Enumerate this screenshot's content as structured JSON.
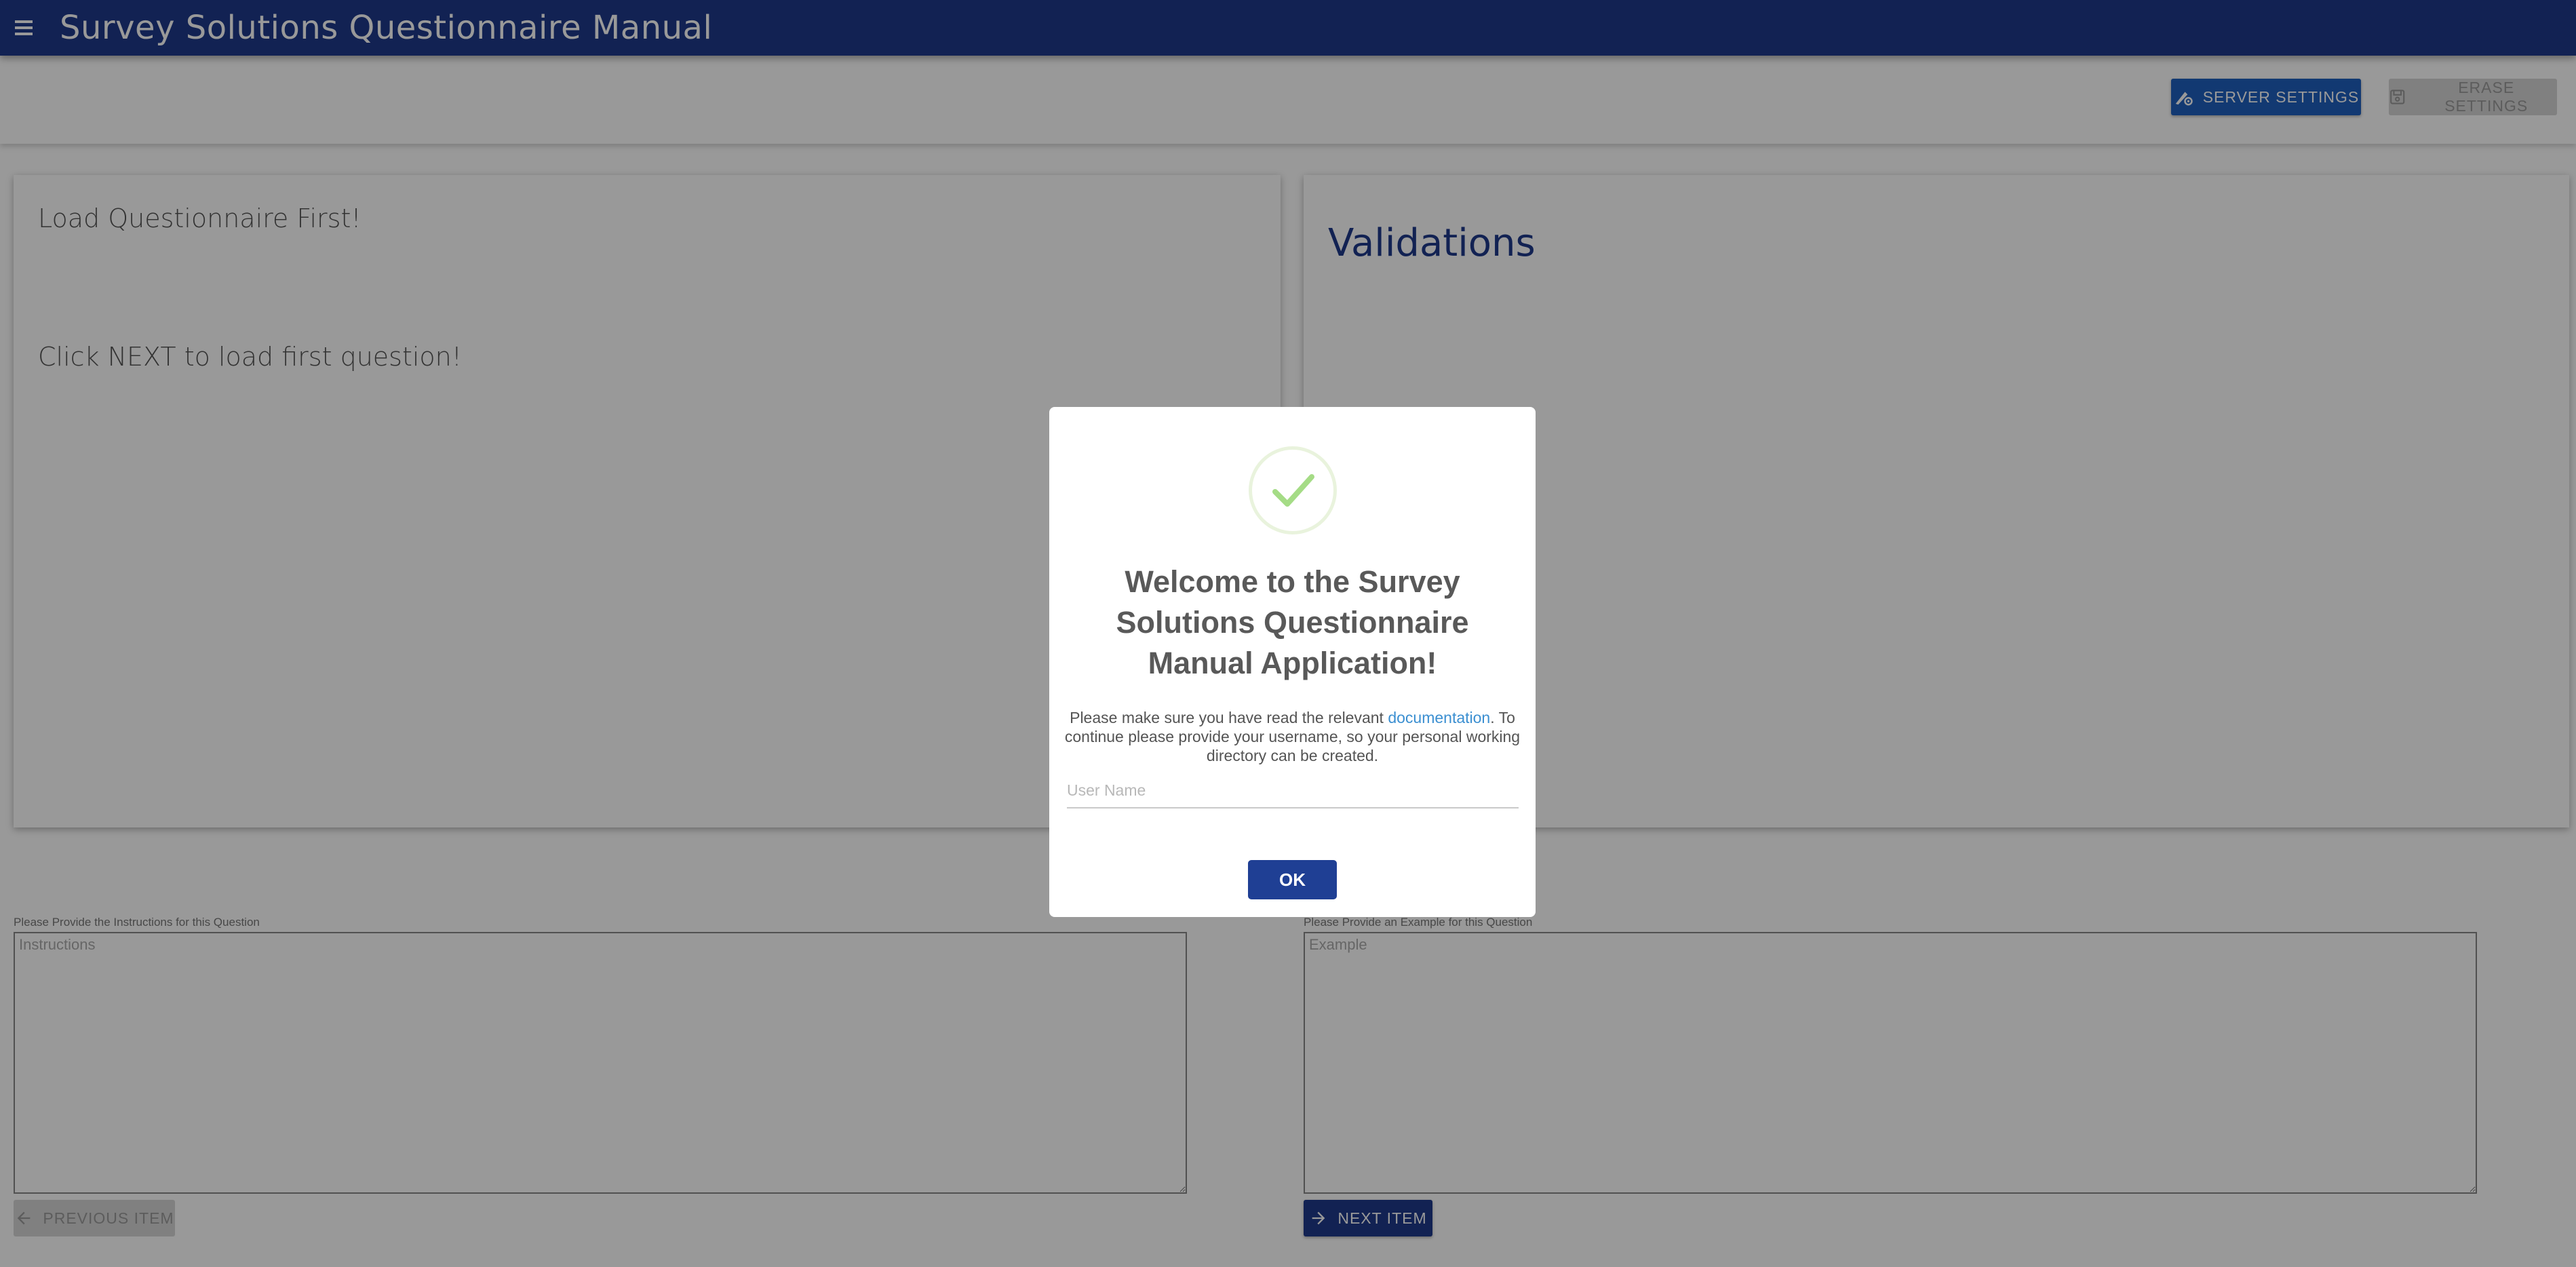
{
  "header": {
    "title": "Survey Solutions Questionnaire Manual",
    "menu_icon": "menu-icon"
  },
  "toolbar": {
    "server_settings_label": "SERVER SETTINGS",
    "server_settings_icon": "settings-icon",
    "erase_settings_label": "ERASE SETTINGS",
    "erase_settings_icon": "save-icon"
  },
  "question_card": {
    "title": "Load Questionnaire First!",
    "hint": "Click NEXT to load first question!"
  },
  "validations_card": {
    "title": "Validations"
  },
  "instructions": {
    "label": "Please Provide the Instructions for this Question",
    "placeholder": "Instructions",
    "value": ""
  },
  "example": {
    "label": "Please Provide an Example for this Question",
    "placeholder": "Example",
    "value": ""
  },
  "nav": {
    "previous_label": "PREVIOUS ITEM",
    "next_label": "NEXT ITEM"
  },
  "modal": {
    "title": "Welcome to the Survey Solutions Questionnaire Manual Application!",
    "text_before_link": "Please make sure you have read the relevant ",
    "link_text": "documentation",
    "text_after_link": ". To continue please provide your username, so your personal working directory can be created.",
    "username_placeholder": "User Name",
    "username_value": "",
    "ok_label": "OK",
    "success_icon": "check-icon"
  },
  "colors": {
    "primary": "#1f3a8a",
    "accent": "#1f5fbf",
    "success": "#a5dc86",
    "link": "#3b8fd1"
  }
}
